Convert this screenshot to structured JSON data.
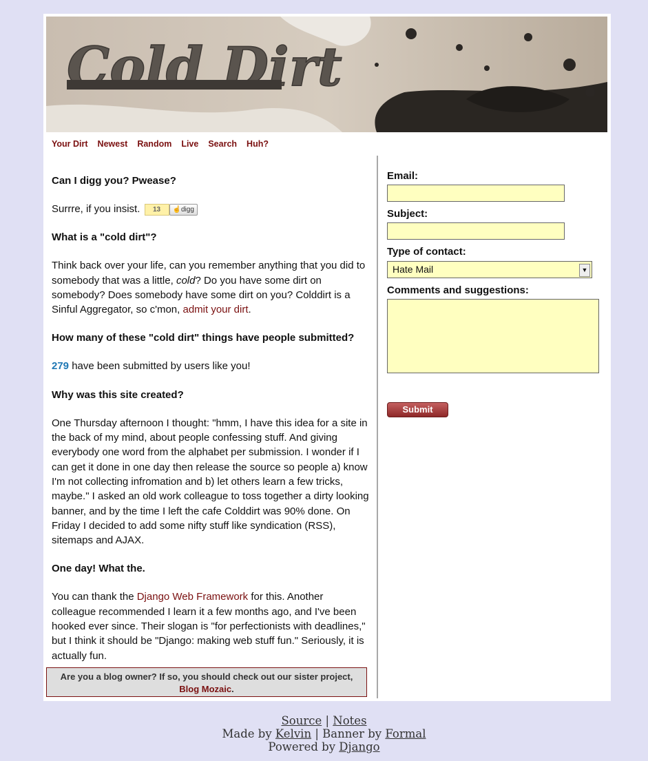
{
  "banner": {
    "logo_text": "Cold Dirt"
  },
  "nav": {
    "items": [
      "Your Dirt",
      "Newest",
      "Random",
      "Live",
      "Search",
      "Huh?"
    ]
  },
  "faq": {
    "q1": "Can I digg you? Pwease?",
    "a1_text": "Surrre, if you insist.",
    "digg_count": "13",
    "digg_label": "digg",
    "q2": "What is a \"cold dirt\"?",
    "a2_part1": "Think back over your life, can you remember anything that you did to somebody that was a little, ",
    "a2_italic": "cold",
    "a2_part2": "? Do you have some dirt on somebody? Does somebody have some dirt on you? Colddirt is a Sinful Aggregator, so c'mon, ",
    "a2_link": "admit your dirt",
    "a2_end": ".",
    "q3": "How many of these \"cold dirt\" things have people submitted?",
    "a3_count": "279",
    "a3_text": " have been submitted by users like you!",
    "q4": "Why was this site created?",
    "a4": "One Thursday afternoon I thought: \"hmm, I have this idea for a site in the back of my mind, about people confessing stuff. And giving everybody one word from the alphabet per submission. I wonder if I can get it done in one day then release the source so people a) know I'm not collecting infromation and b) let others learn a few tricks, maybe.\" I asked an old work colleague to toss together a dirty looking banner, and by the time I left the cafe Colddirt was 90% done. On Friday I decided to add some nifty stuff like syndication (RSS), sitemaps and AJAX.",
    "q5": "One day! What the.",
    "a5_part1": "You can thank the ",
    "a5_link": "Django Web Framework",
    "a5_part2": " for this. Another colleague recommended I learn it a few months ago, and I've been hooked ever since. Their slogan is \"for perfectionists with deadlines,\" but I think it should be \"Django: making web stuff fun.\" Seriously, it is actually fun."
  },
  "sister": {
    "text": "Are you a blog owner? If so, you should check out our sister project,",
    "link": "Blog Mozaic",
    "end": "."
  },
  "form": {
    "email_label": "Email:",
    "subject_label": "Subject:",
    "type_label": "Type of contact:",
    "type_value": "Hate Mail",
    "comments_label": "Comments and suggestions:",
    "submit_label": "Submit"
  },
  "footer": {
    "source": "Source",
    "sep": " | ",
    "notes": "Notes",
    "made_by": "Made by ",
    "kelvin": "Kelvin",
    "banner_by": " | Banner by ",
    "formal": "Formal",
    "powered_by": "Powered by ",
    "django": "Django"
  },
  "colors": {
    "background": "#e0e0f4",
    "link": "#7a1010",
    "count": "#1f78b4",
    "input_fill": "#ffffc0",
    "submit": "#8e2828"
  }
}
